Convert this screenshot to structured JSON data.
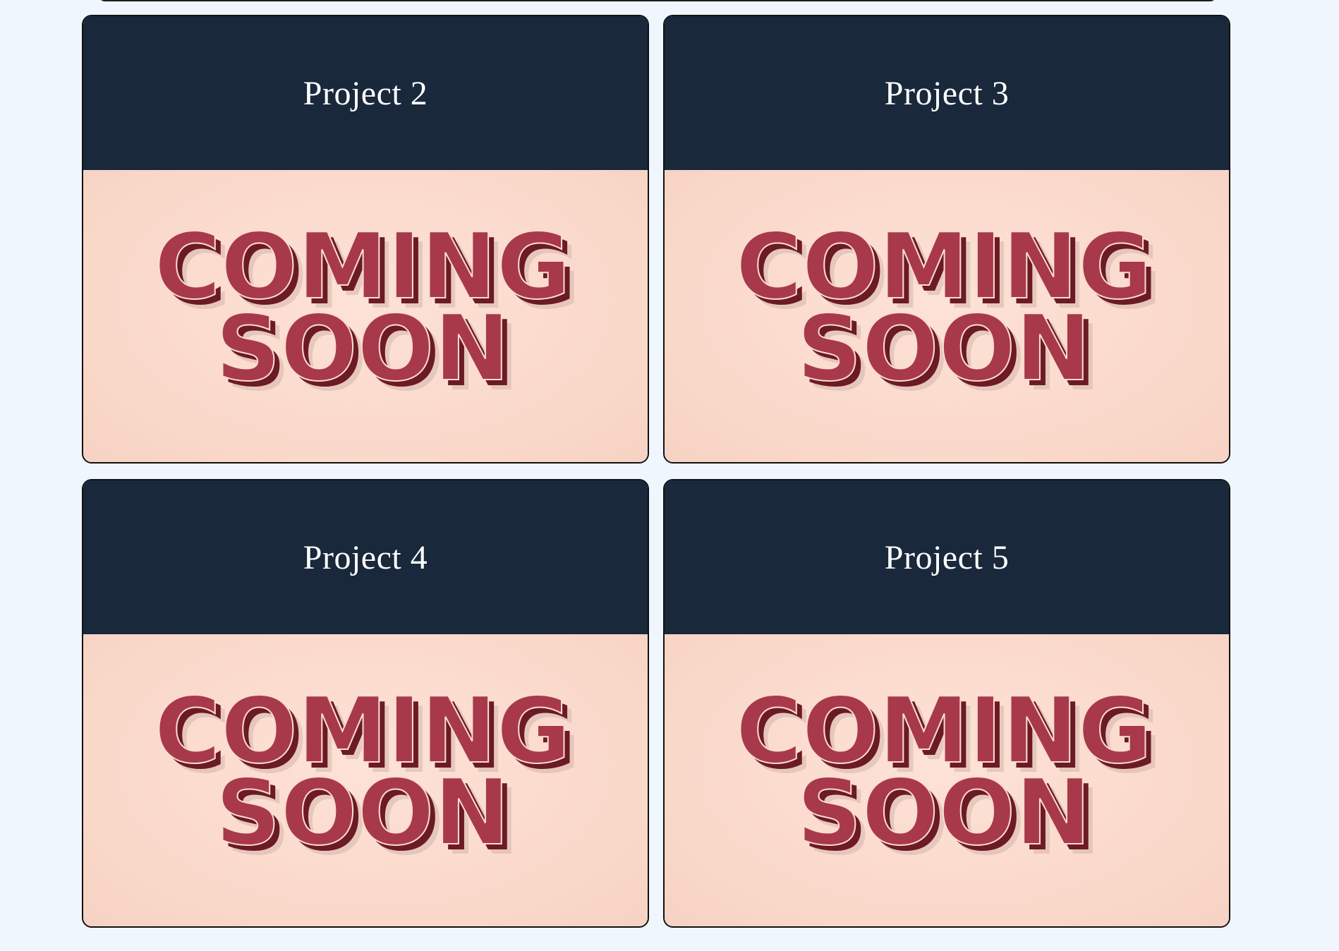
{
  "projects": [
    {
      "title": "Project 2",
      "image_text": {
        "line1": "COMING",
        "line2": "SOON"
      }
    },
    {
      "title": "Project 3",
      "image_text": {
        "line1": "COMING",
        "line2": "SOON"
      }
    },
    {
      "title": "Project 4",
      "image_text": {
        "line1": "COMING",
        "line2": "SOON"
      }
    },
    {
      "title": "Project 5",
      "image_text": {
        "line1": "COMING",
        "line2": "SOON"
      }
    }
  ],
  "colors": {
    "page_background": "#f0f6fe",
    "card_header": "#19283b",
    "card_image_background": "#fadcd0",
    "coming_soon_fill": "#a8394a",
    "coming_soon_shadow": "#6b1a26"
  }
}
